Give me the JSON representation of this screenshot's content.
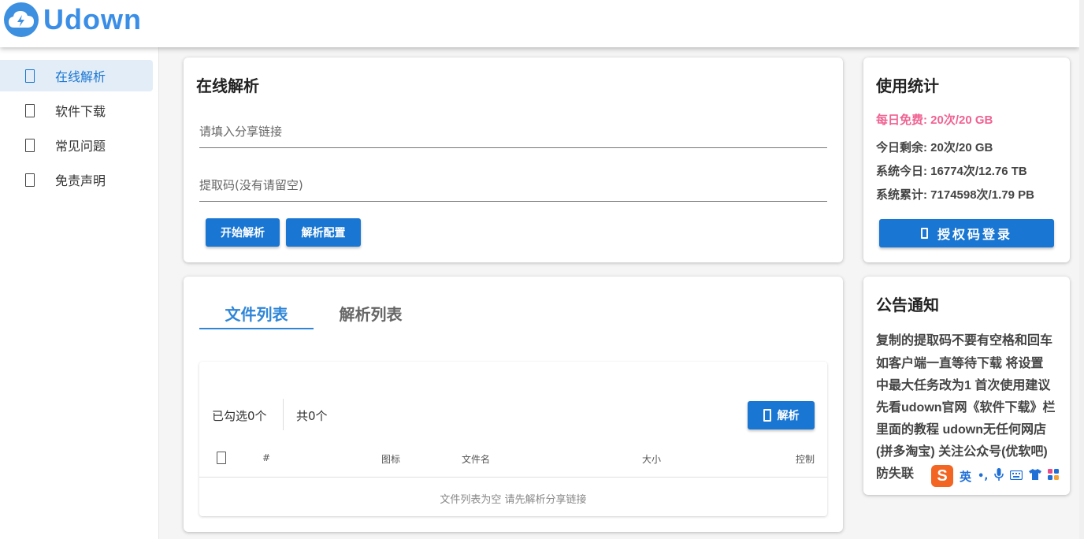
{
  "app": {
    "name": "Udown"
  },
  "sidebar": {
    "items": [
      {
        "label": "在线解析",
        "active": true
      },
      {
        "label": "软件下载",
        "active": false
      },
      {
        "label": "常见问题",
        "active": false
      },
      {
        "label": "免责声明",
        "active": false
      }
    ]
  },
  "parse_card": {
    "title": "在线解析",
    "link_placeholder": "请填入分享链接",
    "code_placeholder": "提取码(没有请留空)",
    "start_button": "开始解析",
    "config_button": "解析配置"
  },
  "files_card": {
    "tabs": [
      "文件列表",
      "解析列表"
    ],
    "selected_count": "已勾选0个",
    "total_count": "共0个",
    "parse_button": "解析",
    "columns": [
      "#",
      "图标",
      "文件名",
      "大小",
      "控制"
    ],
    "empty_message": "文件列表为空 请先解析分享链接"
  },
  "stats_card": {
    "title": "使用统计",
    "daily_free": "每日免费: 20次/20 GB",
    "today_remaining": "今日剩余: 20次/20 GB",
    "system_today": "系统今日: 16774次/12.76 TB",
    "system_total": "系统累计: 7174598次/1.79 PB",
    "login_button": "授权码登录"
  },
  "notice_card": {
    "title": "公告通知",
    "lines": [
      "复制的提取码不要有空格和回车",
      "如客户端一直等待下载 将设置",
      "中最大任务改为1 首次使用建议",
      "先看udown官网《软件下载》栏",
      "里面的教程 udown无任何网店",
      "(拼多淘宝) 关注公众号(优软吧)",
      "防失联"
    ]
  },
  "ime": {
    "logo": "S",
    "mode": "英",
    "punct": "•,"
  },
  "colors": {
    "primary": "#1976d2",
    "tab_active": "#2f86d8",
    "highlight": "#f06292",
    "logo_blue": "#3a8ee6"
  }
}
